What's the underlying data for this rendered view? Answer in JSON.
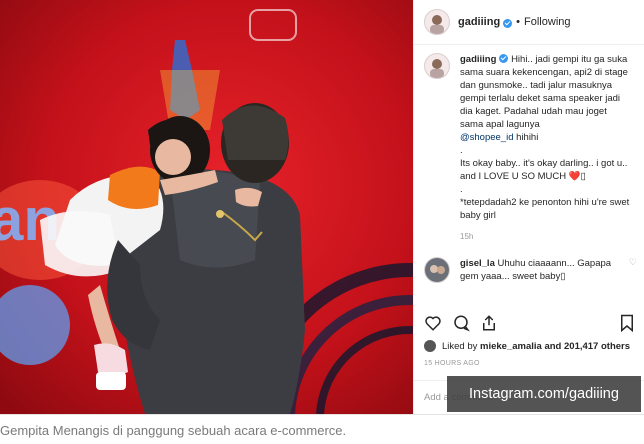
{
  "post": {
    "username": "gadiiing",
    "follow_status": "Following",
    "separator": "•",
    "caption_username": "gadiiing",
    "caption_lines": [
      "Hihi.. jadi gempi itu ga suka sama suara kekencengan, api2 di stage dan gunsmoke.. tadi jalur masuknya gempi terlalu deket sama speaker jadi dia kaget. Padahal udah mau joget sama apal lagunya",
      "@shopee_id",
      "hihihi",
      ".",
      "Its okay baby.. it's okay darling.. i got u.. and I LOVE U SO MUCH ❤️▯",
      ".",
      "*tetepdadah2 ke penonton hihi u're swet baby girl"
    ],
    "caption_time": "15h",
    "comment": {
      "username": "gisel_la",
      "text": "Uhuhu ciaaaann... Gapapa gem yaaa... sweet baby▯"
    },
    "liked_by_prefix": "Liked by",
    "liked_by_user": "mieke_amalia",
    "liked_by_suffix": "and 201,417 others",
    "time_ago": "15 HOURS AGO",
    "add_comment_placeholder": "Add a comment..."
  },
  "overlay_text": "Instagram.com/gadiiing",
  "article_caption": "Gempita Menangis di panggung sebuah acara e-commerce.",
  "icons": {
    "like": "heart-icon",
    "comment": "comment-icon",
    "share": "share-icon",
    "save": "bookmark-icon"
  },
  "colors": {
    "stage_red": "#c8101c",
    "verified_blue": "#3897f0",
    "link_blue": "#003569"
  }
}
